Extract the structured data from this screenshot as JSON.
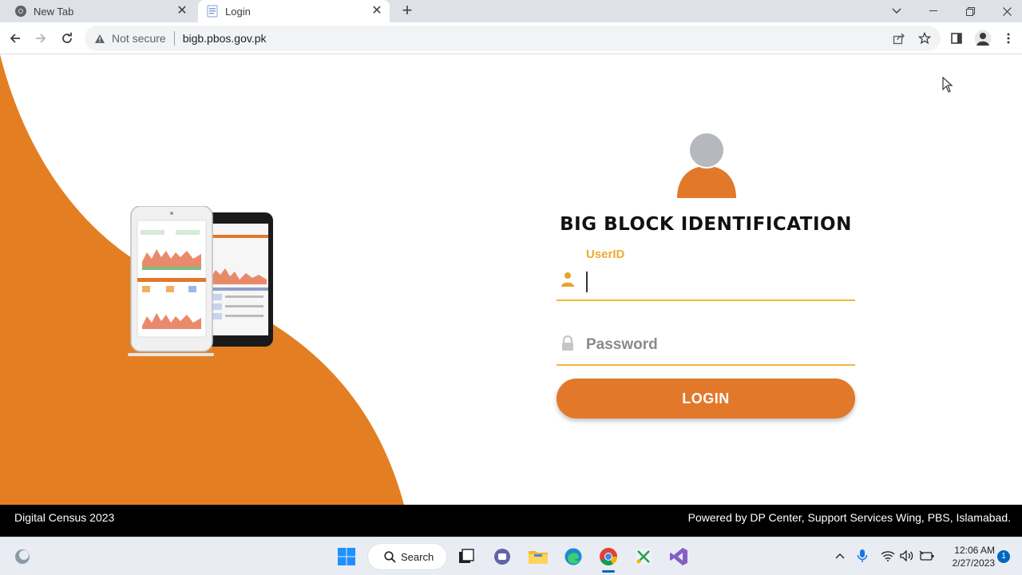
{
  "browser": {
    "tabs": [
      {
        "title": "New Tab",
        "icon": "chrome-icon",
        "active": false
      },
      {
        "title": "Login",
        "icon": "page-icon",
        "active": true
      }
    ],
    "address": {
      "security_text": "Not secure",
      "url": "bigb.pbos.gov.pk"
    }
  },
  "login": {
    "title": "BIG BLOCK IDENTIFICATION",
    "userid_label": "UserID",
    "userid_value": "",
    "password_placeholder": "Password",
    "button_label": "LOGIN"
  },
  "footer": {
    "left": "Digital Census 2023",
    "right": "Powered by DP Center, Support Services Wing, PBS, Islamabad."
  },
  "taskbar": {
    "search_label": "Search",
    "time": "12:06 AM",
    "date": "2/27/2023",
    "notification_count": "1"
  },
  "colors": {
    "accent": "#e2782a",
    "field_line": "#f0b63a",
    "label": "#f0a830"
  }
}
